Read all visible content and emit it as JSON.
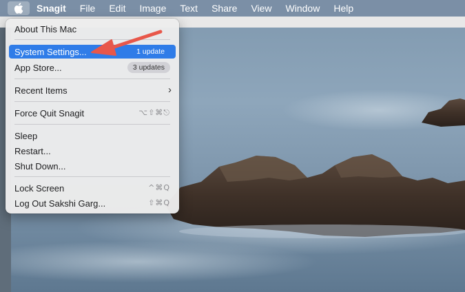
{
  "menubar": {
    "app_name": "Snagit",
    "menus": [
      "File",
      "Edit",
      "Image",
      "Text",
      "Share",
      "View",
      "Window",
      "Help"
    ]
  },
  "apple_menu": {
    "about": "About This Mac",
    "system_settings": "System Settings...",
    "system_settings_badge": "1 update",
    "app_store": "App Store...",
    "app_store_badge": "3 updates",
    "recent_items": "Recent Items",
    "force_quit": "Force Quit Snagit",
    "force_quit_shortcut": "⌥⇧⌘⎋",
    "sleep": "Sleep",
    "restart": "Restart...",
    "shut_down": "Shut Down...",
    "lock_screen": "Lock Screen",
    "lock_screen_shortcut": "^⌘Q",
    "log_out": "Log Out Sakshi Garg...",
    "log_out_shortcut": "⇧⌘Q"
  },
  "colors": {
    "selection": "#2f7ce8",
    "arrow": "#e8574a",
    "menubar": "#7b8fa6"
  }
}
